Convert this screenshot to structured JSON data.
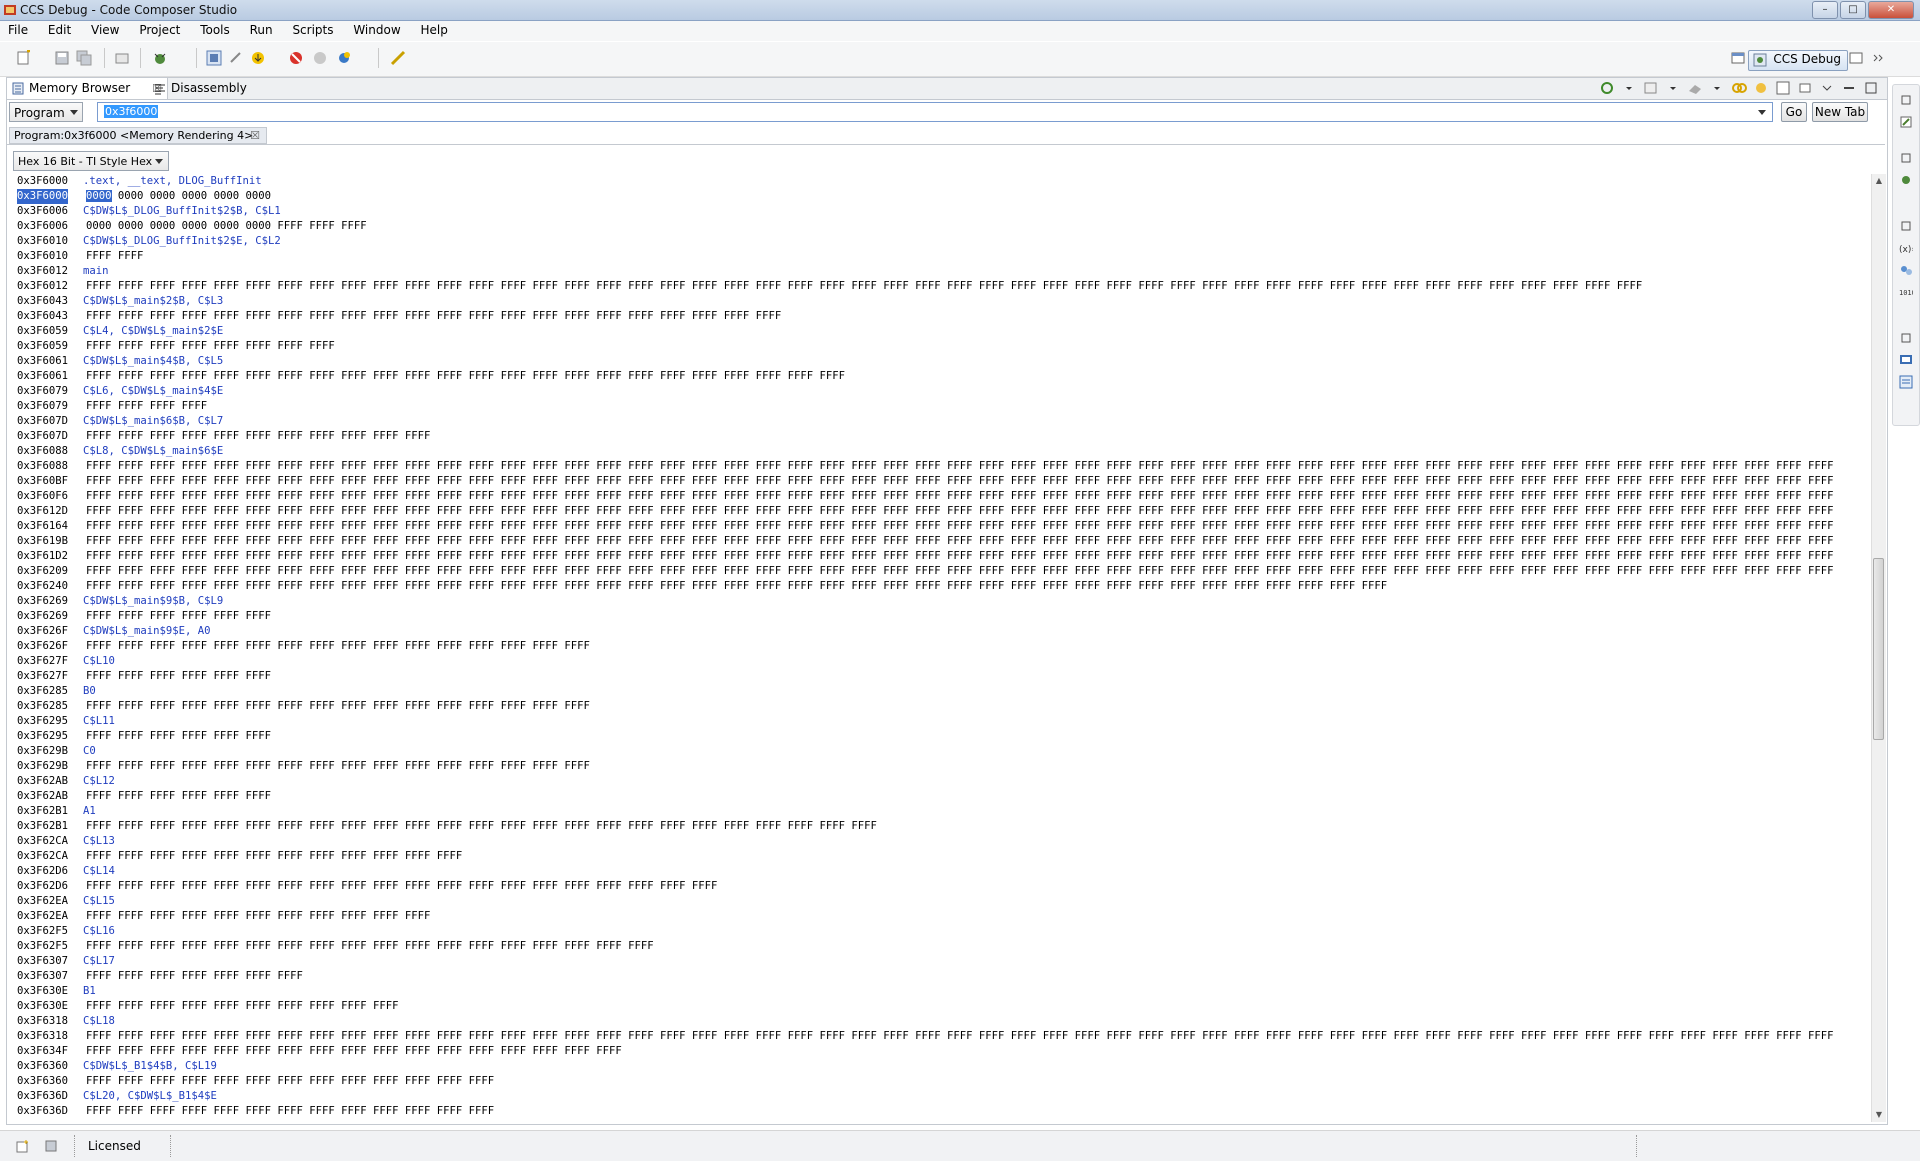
{
  "window": {
    "title": "CCS Debug - Code Composer Studio",
    "min": "–",
    "max": "□",
    "close": "✕"
  },
  "menu": [
    "File",
    "Edit",
    "View",
    "Project",
    "Tools",
    "Run",
    "Scripts",
    "Window",
    "Help"
  ],
  "perspective": {
    "label": "CCS Debug"
  },
  "tabs": {
    "active": "Memory Browser",
    "inactive": "Disassembly",
    "close": "☒"
  },
  "address_bar": {
    "space": "Program",
    "value": "0x3f6000",
    "go": "Go",
    "new_tab": "New Tab"
  },
  "rendering_tab": {
    "label": "Program:0x3f6000 <Memory Rendering 4>"
  },
  "format": {
    "value": "Hex 16 Bit - TI Style Hex"
  },
  "status": {
    "license": "Licensed"
  },
  "memory_rows": [
    {
      "addr": "0x3F6000",
      "label": ".text, __text, DLOG_BuffInit"
    },
    {
      "addr": "0x3F6000",
      "hex": "0000 0000 0000 0000 0000 0000",
      "selected": true
    },
    {
      "addr": "0x3F6006",
      "label": "C$DW$L$_DLOG_BuffInit$2$B, C$L1"
    },
    {
      "addr": "0x3F6006",
      "hex": "0000 0000 0000 0000 0000 0000 FFFF FFFF FFFF"
    },
    {
      "addr": "0x3F6010",
      "label": "C$DW$L$_DLOG_BuffInit$2$E, C$L2"
    },
    {
      "addr": "0x3F6010",
      "hex": "FFFF FFFF"
    },
    {
      "addr": "0x3F6012",
      "label": "main"
    },
    {
      "addr": "0x3F6012",
      "hex": "FFFF FFFF FFFF FFFF FFFF FFFF FFFF FFFF FFFF FFFF FFFF FFFF FFFF FFFF FFFF FFFF FFFF FFFF FFFF FFFF FFFF FFFF FFFF FFFF FFFF FFFF FFFF FFFF FFFF FFFF FFFF FFFF FFFF FFFF FFFF FFFF FFFF FFFF FFFF FFFF FFFF FFFF FFFF FFFF FFFF FFFF FFFF FFFF FFFF"
    },
    {
      "addr": "0x3F6043",
      "label": "C$DW$L$_main$2$B, C$L3"
    },
    {
      "addr": "0x3F6043",
      "hex": "FFFF FFFF FFFF FFFF FFFF FFFF FFFF FFFF FFFF FFFF FFFF FFFF FFFF FFFF FFFF FFFF FFFF FFFF FFFF FFFF FFFF FFFF"
    },
    {
      "addr": "0x3F6059",
      "label": "C$L4, C$DW$L$_main$2$E"
    },
    {
      "addr": "0x3F6059",
      "hex": "FFFF FFFF FFFF FFFF FFFF FFFF FFFF FFFF"
    },
    {
      "addr": "0x3F6061",
      "label": "C$DW$L$_main$4$B, C$L5"
    },
    {
      "addr": "0x3F6061",
      "hex": "FFFF FFFF FFFF FFFF FFFF FFFF FFFF FFFF FFFF FFFF FFFF FFFF FFFF FFFF FFFF FFFF FFFF FFFF FFFF FFFF FFFF FFFF FFFF FFFF"
    },
    {
      "addr": "0x3F6079",
      "label": "C$L6, C$DW$L$_main$4$E"
    },
    {
      "addr": "0x3F6079",
      "hex": "FFFF FFFF FFFF FFFF"
    },
    {
      "addr": "0x3F607D",
      "label": "C$DW$L$_main$6$B, C$L7"
    },
    {
      "addr": "0x3F607D",
      "hex": "FFFF FFFF FFFF FFFF FFFF FFFF FFFF FFFF FFFF FFFF FFFF"
    },
    {
      "addr": "0x3F6088",
      "label": "C$L8, C$DW$L$_main$6$E"
    },
    {
      "addr": "0x3F6088",
      "hex": "FFFF FFFF FFFF FFFF FFFF FFFF FFFF FFFF FFFF FFFF FFFF FFFF FFFF FFFF FFFF FFFF FFFF FFFF FFFF FFFF FFFF FFFF FFFF FFFF FFFF FFFF FFFF FFFF FFFF FFFF FFFF FFFF FFFF FFFF FFFF FFFF FFFF FFFF FFFF FFFF FFFF FFFF FFFF FFFF FFFF FFFF FFFF FFFF FFFF FFFF FFFF FFFF FFFF FFFF FFFF"
    },
    {
      "addr": "0x3F60BF",
      "hex": "FFFF FFFF FFFF FFFF FFFF FFFF FFFF FFFF FFFF FFFF FFFF FFFF FFFF FFFF FFFF FFFF FFFF FFFF FFFF FFFF FFFF FFFF FFFF FFFF FFFF FFFF FFFF FFFF FFFF FFFF FFFF FFFF FFFF FFFF FFFF FFFF FFFF FFFF FFFF FFFF FFFF FFFF FFFF FFFF FFFF FFFF FFFF FFFF FFFF FFFF FFFF FFFF FFFF FFFF FFFF"
    },
    {
      "addr": "0x3F60F6",
      "hex": "FFFF FFFF FFFF FFFF FFFF FFFF FFFF FFFF FFFF FFFF FFFF FFFF FFFF FFFF FFFF FFFF FFFF FFFF FFFF FFFF FFFF FFFF FFFF FFFF FFFF FFFF FFFF FFFF FFFF FFFF FFFF FFFF FFFF FFFF FFFF FFFF FFFF FFFF FFFF FFFF FFFF FFFF FFFF FFFF FFFF FFFF FFFF FFFF FFFF FFFF FFFF FFFF FFFF FFFF FFFF"
    },
    {
      "addr": "0x3F612D",
      "hex": "FFFF FFFF FFFF FFFF FFFF FFFF FFFF FFFF FFFF FFFF FFFF FFFF FFFF FFFF FFFF FFFF FFFF FFFF FFFF FFFF FFFF FFFF FFFF FFFF FFFF FFFF FFFF FFFF FFFF FFFF FFFF FFFF FFFF FFFF FFFF FFFF FFFF FFFF FFFF FFFF FFFF FFFF FFFF FFFF FFFF FFFF FFFF FFFF FFFF FFFF FFFF FFFF FFFF FFFF FFFF"
    },
    {
      "addr": "0x3F6164",
      "hex": "FFFF FFFF FFFF FFFF FFFF FFFF FFFF FFFF FFFF FFFF FFFF FFFF FFFF FFFF FFFF FFFF FFFF FFFF FFFF FFFF FFFF FFFF FFFF FFFF FFFF FFFF FFFF FFFF FFFF FFFF FFFF FFFF FFFF FFFF FFFF FFFF FFFF FFFF FFFF FFFF FFFF FFFF FFFF FFFF FFFF FFFF FFFF FFFF FFFF FFFF FFFF FFFF FFFF FFFF FFFF"
    },
    {
      "addr": "0x3F619B",
      "hex": "FFFF FFFF FFFF FFFF FFFF FFFF FFFF FFFF FFFF FFFF FFFF FFFF FFFF FFFF FFFF FFFF FFFF FFFF FFFF FFFF FFFF FFFF FFFF FFFF FFFF FFFF FFFF FFFF FFFF FFFF FFFF FFFF FFFF FFFF FFFF FFFF FFFF FFFF FFFF FFFF FFFF FFFF FFFF FFFF FFFF FFFF FFFF FFFF FFFF FFFF FFFF FFFF FFFF FFFF FFFF"
    },
    {
      "addr": "0x3F61D2",
      "hex": "FFFF FFFF FFFF FFFF FFFF FFFF FFFF FFFF FFFF FFFF FFFF FFFF FFFF FFFF FFFF FFFF FFFF FFFF FFFF FFFF FFFF FFFF FFFF FFFF FFFF FFFF FFFF FFFF FFFF FFFF FFFF FFFF FFFF FFFF FFFF FFFF FFFF FFFF FFFF FFFF FFFF FFFF FFFF FFFF FFFF FFFF FFFF FFFF FFFF FFFF FFFF FFFF FFFF FFFF FFFF"
    },
    {
      "addr": "0x3F6209",
      "hex": "FFFF FFFF FFFF FFFF FFFF FFFF FFFF FFFF FFFF FFFF FFFF FFFF FFFF FFFF FFFF FFFF FFFF FFFF FFFF FFFF FFFF FFFF FFFF FFFF FFFF FFFF FFFF FFFF FFFF FFFF FFFF FFFF FFFF FFFF FFFF FFFF FFFF FFFF FFFF FFFF FFFF FFFF FFFF FFFF FFFF FFFF FFFF FFFF FFFF FFFF FFFF FFFF FFFF FFFF FFFF"
    },
    {
      "addr": "0x3F6240",
      "hex": "FFFF FFFF FFFF FFFF FFFF FFFF FFFF FFFF FFFF FFFF FFFF FFFF FFFF FFFF FFFF FFFF FFFF FFFF FFFF FFFF FFFF FFFF FFFF FFFF FFFF FFFF FFFF FFFF FFFF FFFF FFFF FFFF FFFF FFFF FFFF FFFF FFFF FFFF FFFF FFFF FFFF"
    },
    {
      "addr": "0x3F6269",
      "label": "C$DW$L$_main$9$B, C$L9"
    },
    {
      "addr": "0x3F6269",
      "hex": "FFFF FFFF FFFF FFFF FFFF FFFF"
    },
    {
      "addr": "0x3F626F",
      "label": "C$DW$L$_main$9$E, A0"
    },
    {
      "addr": "0x3F626F",
      "hex": "FFFF FFFF FFFF FFFF FFFF FFFF FFFF FFFF FFFF FFFF FFFF FFFF FFFF FFFF FFFF FFFF"
    },
    {
      "addr": "0x3F627F",
      "label": "C$L10"
    },
    {
      "addr": "0x3F627F",
      "hex": "FFFF FFFF FFFF FFFF FFFF FFFF"
    },
    {
      "addr": "0x3F6285",
      "label": "B0"
    },
    {
      "addr": "0x3F6285",
      "hex": "FFFF FFFF FFFF FFFF FFFF FFFF FFFF FFFF FFFF FFFF FFFF FFFF FFFF FFFF FFFF FFFF"
    },
    {
      "addr": "0x3F6295",
      "label": "C$L11"
    },
    {
      "addr": "0x3F6295",
      "hex": "FFFF FFFF FFFF FFFF FFFF FFFF"
    },
    {
      "addr": "0x3F629B",
      "label": "C0"
    },
    {
      "addr": "0x3F629B",
      "hex": "FFFF FFFF FFFF FFFF FFFF FFFF FFFF FFFF FFFF FFFF FFFF FFFF FFFF FFFF FFFF FFFF"
    },
    {
      "addr": "0x3F62AB",
      "label": "C$L12"
    },
    {
      "addr": "0x3F62AB",
      "hex": "FFFF FFFF FFFF FFFF FFFF FFFF"
    },
    {
      "addr": "0x3F62B1",
      "label": "A1"
    },
    {
      "addr": "0x3F62B1",
      "hex": "FFFF FFFF FFFF FFFF FFFF FFFF FFFF FFFF FFFF FFFF FFFF FFFF FFFF FFFF FFFF FFFF FFFF FFFF FFFF FFFF FFFF FFFF FFFF FFFF FFFF"
    },
    {
      "addr": "0x3F62CA",
      "label": "C$L13"
    },
    {
      "addr": "0x3F62CA",
      "hex": "FFFF FFFF FFFF FFFF FFFF FFFF FFFF FFFF FFFF FFFF FFFF FFFF"
    },
    {
      "addr": "0x3F62D6",
      "label": "C$L14"
    },
    {
      "addr": "0x3F62D6",
      "hex": "FFFF FFFF FFFF FFFF FFFF FFFF FFFF FFFF FFFF FFFF FFFF FFFF FFFF FFFF FFFF FFFF FFFF FFFF FFFF FFFF"
    },
    {
      "addr": "0x3F62EA",
      "label": "C$L15"
    },
    {
      "addr": "0x3F62EA",
      "hex": "FFFF FFFF FFFF FFFF FFFF FFFF FFFF FFFF FFFF FFFF FFFF"
    },
    {
      "addr": "0x3F62F5",
      "label": "C$L16"
    },
    {
      "addr": "0x3F62F5",
      "hex": "FFFF FFFF FFFF FFFF FFFF FFFF FFFF FFFF FFFF FFFF FFFF FFFF FFFF FFFF FFFF FFFF FFFF FFFF"
    },
    {
      "addr": "0x3F6307",
      "label": "C$L17"
    },
    {
      "addr": "0x3F6307",
      "hex": "FFFF FFFF FFFF FFFF FFFF FFFF FFFF"
    },
    {
      "addr": "0x3F630E",
      "label": "B1"
    },
    {
      "addr": "0x3F630E",
      "hex": "FFFF FFFF FFFF FFFF FFFF FFFF FFFF FFFF FFFF FFFF"
    },
    {
      "addr": "0x3F6318",
      "label": "C$L18"
    },
    {
      "addr": "0x3F6318",
      "hex": "FFFF FFFF FFFF FFFF FFFF FFFF FFFF FFFF FFFF FFFF FFFF FFFF FFFF FFFF FFFF FFFF FFFF FFFF FFFF FFFF FFFF FFFF FFFF FFFF FFFF FFFF FFFF FFFF FFFF FFFF FFFF FFFF FFFF FFFF FFFF FFFF FFFF FFFF FFFF FFFF FFFF FFFF FFFF FFFF FFFF FFFF FFFF FFFF FFFF FFFF FFFF FFFF FFFF FFFF FFFF"
    },
    {
      "addr": "0x3F634F",
      "hex": "FFFF FFFF FFFF FFFF FFFF FFFF FFFF FFFF FFFF FFFF FFFF FFFF FFFF FFFF FFFF FFFF FFFF"
    },
    {
      "addr": "0x3F6360",
      "label": "C$DW$L$_B1$4$B, C$L19"
    },
    {
      "addr": "0x3F6360",
      "hex": "FFFF FFFF FFFF FFFF FFFF FFFF FFFF FFFF FFFF FFFF FFFF FFFF FFFF"
    },
    {
      "addr": "0x3F636D",
      "label": "C$L20, C$DW$L$_B1$4$E"
    },
    {
      "addr": "0x3F636D",
      "hex": "FFFF FFFF FFFF FFFF FFFF FFFF FFFF FFFF FFFF FFFF FFFF FFFF FFFF"
    }
  ]
}
